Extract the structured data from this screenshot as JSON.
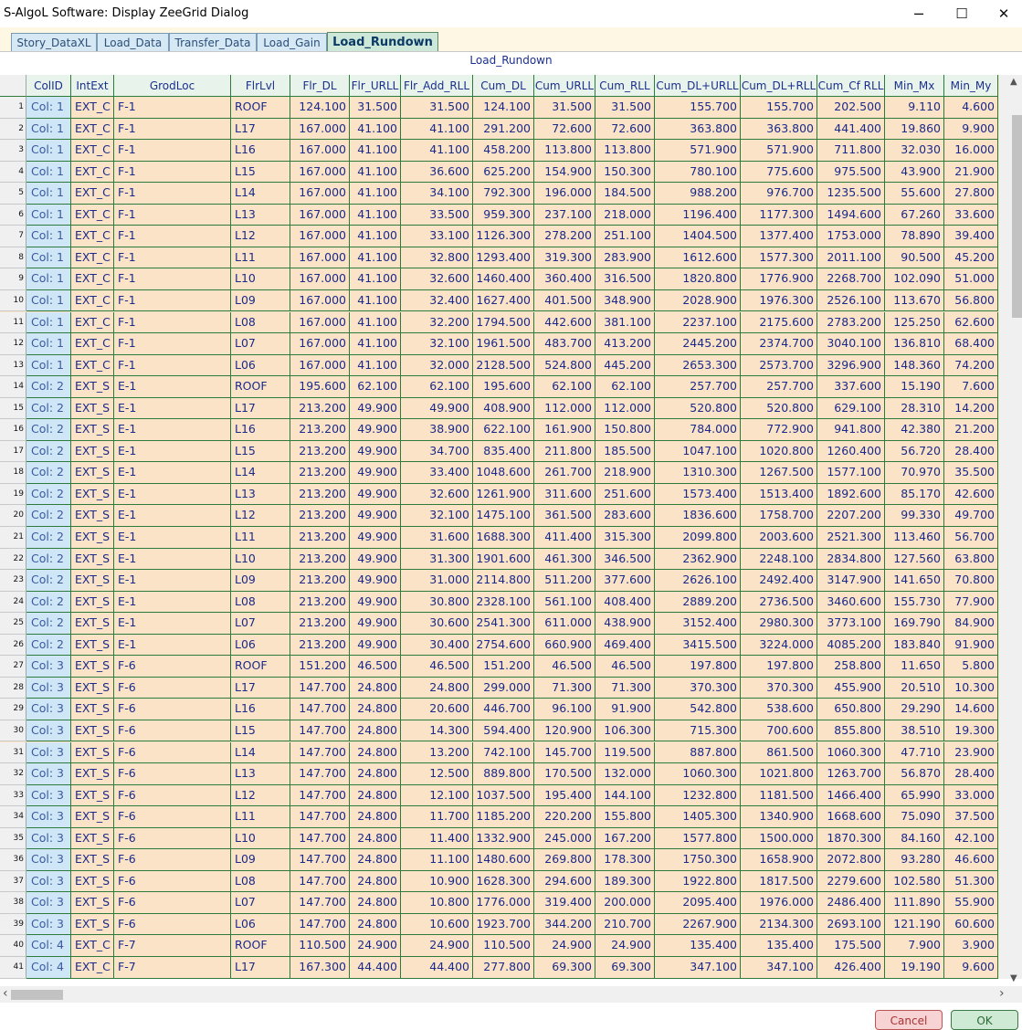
{
  "window": {
    "title": "S-AlgoL Software: Display ZeeGrid Dialog",
    "minimize": "─",
    "maximize": "☐",
    "close": "✕"
  },
  "tabs": [
    {
      "label": "Story_DataXL"
    },
    {
      "label": "Load_Data"
    },
    {
      "label": "Transfer_Data"
    },
    {
      "label": "Load_Gain"
    },
    {
      "label": "Load_Rundown",
      "active": true
    }
  ],
  "grid": {
    "title": "Load_Rundown",
    "columns": [
      "ColID",
      "IntExt",
      "GrodLoc",
      "FlrLvl",
      "Flr_DL",
      "Flr_URLL",
      "Flr_Add_RLL",
      "Cum_DL",
      "Cum_URLL",
      "Cum_RLL",
      "Cum_DL+URLL",
      "Cum_DL+RLL",
      "Cum_Cf RLL",
      "Min_Mx",
      "Min_My"
    ],
    "rows": [
      [
        "1",
        "Col: 1",
        "EXT_C",
        "F-1",
        "ROOF",
        "124.100",
        "31.500",
        "31.500",
        "124.100",
        "31.500",
        "31.500",
        "155.700",
        "155.700",
        "202.500",
        "9.110",
        "4.600"
      ],
      [
        "2",
        "Col: 1",
        "EXT_C",
        "F-1",
        "L17",
        "167.000",
        "41.100",
        "41.100",
        "291.200",
        "72.600",
        "72.600",
        "363.800",
        "363.800",
        "441.400",
        "19.860",
        "9.900"
      ],
      [
        "3",
        "Col: 1",
        "EXT_C",
        "F-1",
        "L16",
        "167.000",
        "41.100",
        "41.100",
        "458.200",
        "113.800",
        "113.800",
        "571.900",
        "571.900",
        "711.800",
        "32.030",
        "16.000"
      ],
      [
        "4",
        "Col: 1",
        "EXT_C",
        "F-1",
        "L15",
        "167.000",
        "41.100",
        "36.600",
        "625.200",
        "154.900",
        "150.300",
        "780.100",
        "775.600",
        "975.500",
        "43.900",
        "21.900"
      ],
      [
        "5",
        "Col: 1",
        "EXT_C",
        "F-1",
        "L14",
        "167.000",
        "41.100",
        "34.100",
        "792.300",
        "196.000",
        "184.500",
        "988.200",
        "976.700",
        "1235.500",
        "55.600",
        "27.800"
      ],
      [
        "6",
        "Col: 1",
        "EXT_C",
        "F-1",
        "L13",
        "167.000",
        "41.100",
        "33.500",
        "959.300",
        "237.100",
        "218.000",
        "1196.400",
        "1177.300",
        "1494.600",
        "67.260",
        "33.600"
      ],
      [
        "7",
        "Col: 1",
        "EXT_C",
        "F-1",
        "L12",
        "167.000",
        "41.100",
        "33.100",
        "1126.300",
        "278.200",
        "251.100",
        "1404.500",
        "1377.400",
        "1753.000",
        "78.890",
        "39.400"
      ],
      [
        "8",
        "Col: 1",
        "EXT_C",
        "F-1",
        "L11",
        "167.000",
        "41.100",
        "32.800",
        "1293.400",
        "319.300",
        "283.900",
        "1612.600",
        "1577.300",
        "2011.100",
        "90.500",
        "45.200"
      ],
      [
        "9",
        "Col: 1",
        "EXT_C",
        "F-1",
        "L10",
        "167.000",
        "41.100",
        "32.600",
        "1460.400",
        "360.400",
        "316.500",
        "1820.800",
        "1776.900",
        "2268.700",
        "102.090",
        "51.000"
      ],
      [
        "10",
        "Col: 1",
        "EXT_C",
        "F-1",
        "L09",
        "167.000",
        "41.100",
        "32.400",
        "1627.400",
        "401.500",
        "348.900",
        "2028.900",
        "1976.300",
        "2526.100",
        "113.670",
        "56.800"
      ],
      [
        "11",
        "Col: 1",
        "EXT_C",
        "F-1",
        "L08",
        "167.000",
        "41.100",
        "32.200",
        "1794.500",
        "442.600",
        "381.100",
        "2237.100",
        "2175.600",
        "2783.200",
        "125.250",
        "62.600"
      ],
      [
        "12",
        "Col: 1",
        "EXT_C",
        "F-1",
        "L07",
        "167.000",
        "41.100",
        "32.100",
        "1961.500",
        "483.700",
        "413.200",
        "2445.200",
        "2374.700",
        "3040.100",
        "136.810",
        "68.400"
      ],
      [
        "13",
        "Col: 1",
        "EXT_C",
        "F-1",
        "L06",
        "167.000",
        "41.100",
        "32.000",
        "2128.500",
        "524.800",
        "445.200",
        "2653.300",
        "2573.700",
        "3296.900",
        "148.360",
        "74.200"
      ],
      [
        "14",
        "Col: 2",
        "EXT_S",
        "E-1",
        "ROOF",
        "195.600",
        "62.100",
        "62.100",
        "195.600",
        "62.100",
        "62.100",
        "257.700",
        "257.700",
        "337.600",
        "15.190",
        "7.600"
      ],
      [
        "15",
        "Col: 2",
        "EXT_S",
        "E-1",
        "L17",
        "213.200",
        "49.900",
        "49.900",
        "408.900",
        "112.000",
        "112.000",
        "520.800",
        "520.800",
        "629.100",
        "28.310",
        "14.200"
      ],
      [
        "16",
        "Col: 2",
        "EXT_S",
        "E-1",
        "L16",
        "213.200",
        "49.900",
        "38.900",
        "622.100",
        "161.900",
        "150.800",
        "784.000",
        "772.900",
        "941.800",
        "42.380",
        "21.200"
      ],
      [
        "17",
        "Col: 2",
        "EXT_S",
        "E-1",
        "L15",
        "213.200",
        "49.900",
        "34.700",
        "835.400",
        "211.800",
        "185.500",
        "1047.100",
        "1020.800",
        "1260.400",
        "56.720",
        "28.400"
      ],
      [
        "18",
        "Col: 2",
        "EXT_S",
        "E-1",
        "L14",
        "213.200",
        "49.900",
        "33.400",
        "1048.600",
        "261.700",
        "218.900",
        "1310.300",
        "1267.500",
        "1577.100",
        "70.970",
        "35.500"
      ],
      [
        "19",
        "Col: 2",
        "EXT_S",
        "E-1",
        "L13",
        "213.200",
        "49.900",
        "32.600",
        "1261.900",
        "311.600",
        "251.600",
        "1573.400",
        "1513.400",
        "1892.600",
        "85.170",
        "42.600"
      ],
      [
        "20",
        "Col: 2",
        "EXT_S",
        "E-1",
        "L12",
        "213.200",
        "49.900",
        "32.100",
        "1475.100",
        "361.500",
        "283.600",
        "1836.600",
        "1758.700",
        "2207.200",
        "99.330",
        "49.700"
      ],
      [
        "21",
        "Col: 2",
        "EXT_S",
        "E-1",
        "L11",
        "213.200",
        "49.900",
        "31.600",
        "1688.300",
        "411.400",
        "315.300",
        "2099.800",
        "2003.600",
        "2521.300",
        "113.460",
        "56.700"
      ],
      [
        "22",
        "Col: 2",
        "EXT_S",
        "E-1",
        "L10",
        "213.200",
        "49.900",
        "31.300",
        "1901.600",
        "461.300",
        "346.500",
        "2362.900",
        "2248.100",
        "2834.800",
        "127.560",
        "63.800"
      ],
      [
        "23",
        "Col: 2",
        "EXT_S",
        "E-1",
        "L09",
        "213.200",
        "49.900",
        "31.000",
        "2114.800",
        "511.200",
        "377.600",
        "2626.100",
        "2492.400",
        "3147.900",
        "141.650",
        "70.800"
      ],
      [
        "24",
        "Col: 2",
        "EXT_S",
        "E-1",
        "L08",
        "213.200",
        "49.900",
        "30.800",
        "2328.100",
        "561.100",
        "408.400",
        "2889.200",
        "2736.500",
        "3460.600",
        "155.730",
        "77.900"
      ],
      [
        "25",
        "Col: 2",
        "EXT_S",
        "E-1",
        "L07",
        "213.200",
        "49.900",
        "30.600",
        "2541.300",
        "611.000",
        "438.900",
        "3152.400",
        "2980.300",
        "3773.100",
        "169.790",
        "84.900"
      ],
      [
        "26",
        "Col: 2",
        "EXT_S",
        "E-1",
        "L06",
        "213.200",
        "49.900",
        "30.400",
        "2754.600",
        "660.900",
        "469.400",
        "3415.500",
        "3224.000",
        "4085.200",
        "183.840",
        "91.900"
      ],
      [
        "27",
        "Col: 3",
        "EXT_S",
        "F-6",
        "ROOF",
        "151.200",
        "46.500",
        "46.500",
        "151.200",
        "46.500",
        "46.500",
        "197.800",
        "197.800",
        "258.800",
        "11.650",
        "5.800"
      ],
      [
        "28",
        "Col: 3",
        "EXT_S",
        "F-6",
        "L17",
        "147.700",
        "24.800",
        "24.800",
        "299.000",
        "71.300",
        "71.300",
        "370.300",
        "370.300",
        "455.900",
        "20.510",
        "10.300"
      ],
      [
        "29",
        "Col: 3",
        "EXT_S",
        "F-6",
        "L16",
        "147.700",
        "24.800",
        "20.600",
        "446.700",
        "96.100",
        "91.900",
        "542.800",
        "538.600",
        "650.800",
        "29.290",
        "14.600"
      ],
      [
        "30",
        "Col: 3",
        "EXT_S",
        "F-6",
        "L15",
        "147.700",
        "24.800",
        "14.300",
        "594.400",
        "120.900",
        "106.300",
        "715.300",
        "700.600",
        "855.800",
        "38.510",
        "19.300"
      ],
      [
        "31",
        "Col: 3",
        "EXT_S",
        "F-6",
        "L14",
        "147.700",
        "24.800",
        "13.200",
        "742.100",
        "145.700",
        "119.500",
        "887.800",
        "861.500",
        "1060.300",
        "47.710",
        "23.900"
      ],
      [
        "32",
        "Col: 3",
        "EXT_S",
        "F-6",
        "L13",
        "147.700",
        "24.800",
        "12.500",
        "889.800",
        "170.500",
        "132.000",
        "1060.300",
        "1021.800",
        "1263.700",
        "56.870",
        "28.400"
      ],
      [
        "33",
        "Col: 3",
        "EXT_S",
        "F-6",
        "L12",
        "147.700",
        "24.800",
        "12.100",
        "1037.500",
        "195.400",
        "144.100",
        "1232.800",
        "1181.500",
        "1466.400",
        "65.990",
        "33.000"
      ],
      [
        "34",
        "Col: 3",
        "EXT_S",
        "F-6",
        "L11",
        "147.700",
        "24.800",
        "11.700",
        "1185.200",
        "220.200",
        "155.800",
        "1405.300",
        "1340.900",
        "1668.600",
        "75.090",
        "37.500"
      ],
      [
        "35",
        "Col: 3",
        "EXT_S",
        "F-6",
        "L10",
        "147.700",
        "24.800",
        "11.400",
        "1332.900",
        "245.000",
        "167.200",
        "1577.800",
        "1500.000",
        "1870.300",
        "84.160",
        "42.100"
      ],
      [
        "36",
        "Col: 3",
        "EXT_S",
        "F-6",
        "L09",
        "147.700",
        "24.800",
        "11.100",
        "1480.600",
        "269.800",
        "178.300",
        "1750.300",
        "1658.900",
        "2072.800",
        "93.280",
        "46.600"
      ],
      [
        "37",
        "Col: 3",
        "EXT_S",
        "F-6",
        "L08",
        "147.700",
        "24.800",
        "10.900",
        "1628.300",
        "294.600",
        "189.300",
        "1922.800",
        "1817.500",
        "2279.600",
        "102.580",
        "51.300"
      ],
      [
        "38",
        "Col: 3",
        "EXT_S",
        "F-6",
        "L07",
        "147.700",
        "24.800",
        "10.800",
        "1776.000",
        "319.400",
        "200.000",
        "2095.400",
        "1976.000",
        "2486.400",
        "111.890",
        "55.900"
      ],
      [
        "39",
        "Col: 3",
        "EXT_S",
        "F-6",
        "L06",
        "147.700",
        "24.800",
        "10.600",
        "1923.700",
        "344.200",
        "210.700",
        "2267.900",
        "2134.300",
        "2693.100",
        "121.190",
        "60.600"
      ],
      [
        "40",
        "Col: 4",
        "EXT_C",
        "F-7",
        "ROOF",
        "110.500",
        "24.900",
        "24.900",
        "110.500",
        "24.900",
        "24.900",
        "135.400",
        "135.400",
        "175.500",
        "7.900",
        "3.900"
      ],
      [
        "41",
        "Col: 4",
        "EXT_C",
        "F-7",
        "L17",
        "167.300",
        "44.400",
        "44.400",
        "277.800",
        "69.300",
        "69.300",
        "347.100",
        "347.100",
        "426.400",
        "19.190",
        "9.600"
      ]
    ]
  },
  "buttons": {
    "cancel": "Cancel",
    "ok": "OK"
  },
  "colors": {
    "cell_bg": "#fbe3c7",
    "id_col_bg": "#cfe6f7",
    "grid_line": "#2d7a3a",
    "text": "#1a2a8a"
  },
  "icons": {
    "scroll_up": "▲",
    "scroll_down": "▼",
    "scroll_left": "‹",
    "scroll_right": "›"
  }
}
